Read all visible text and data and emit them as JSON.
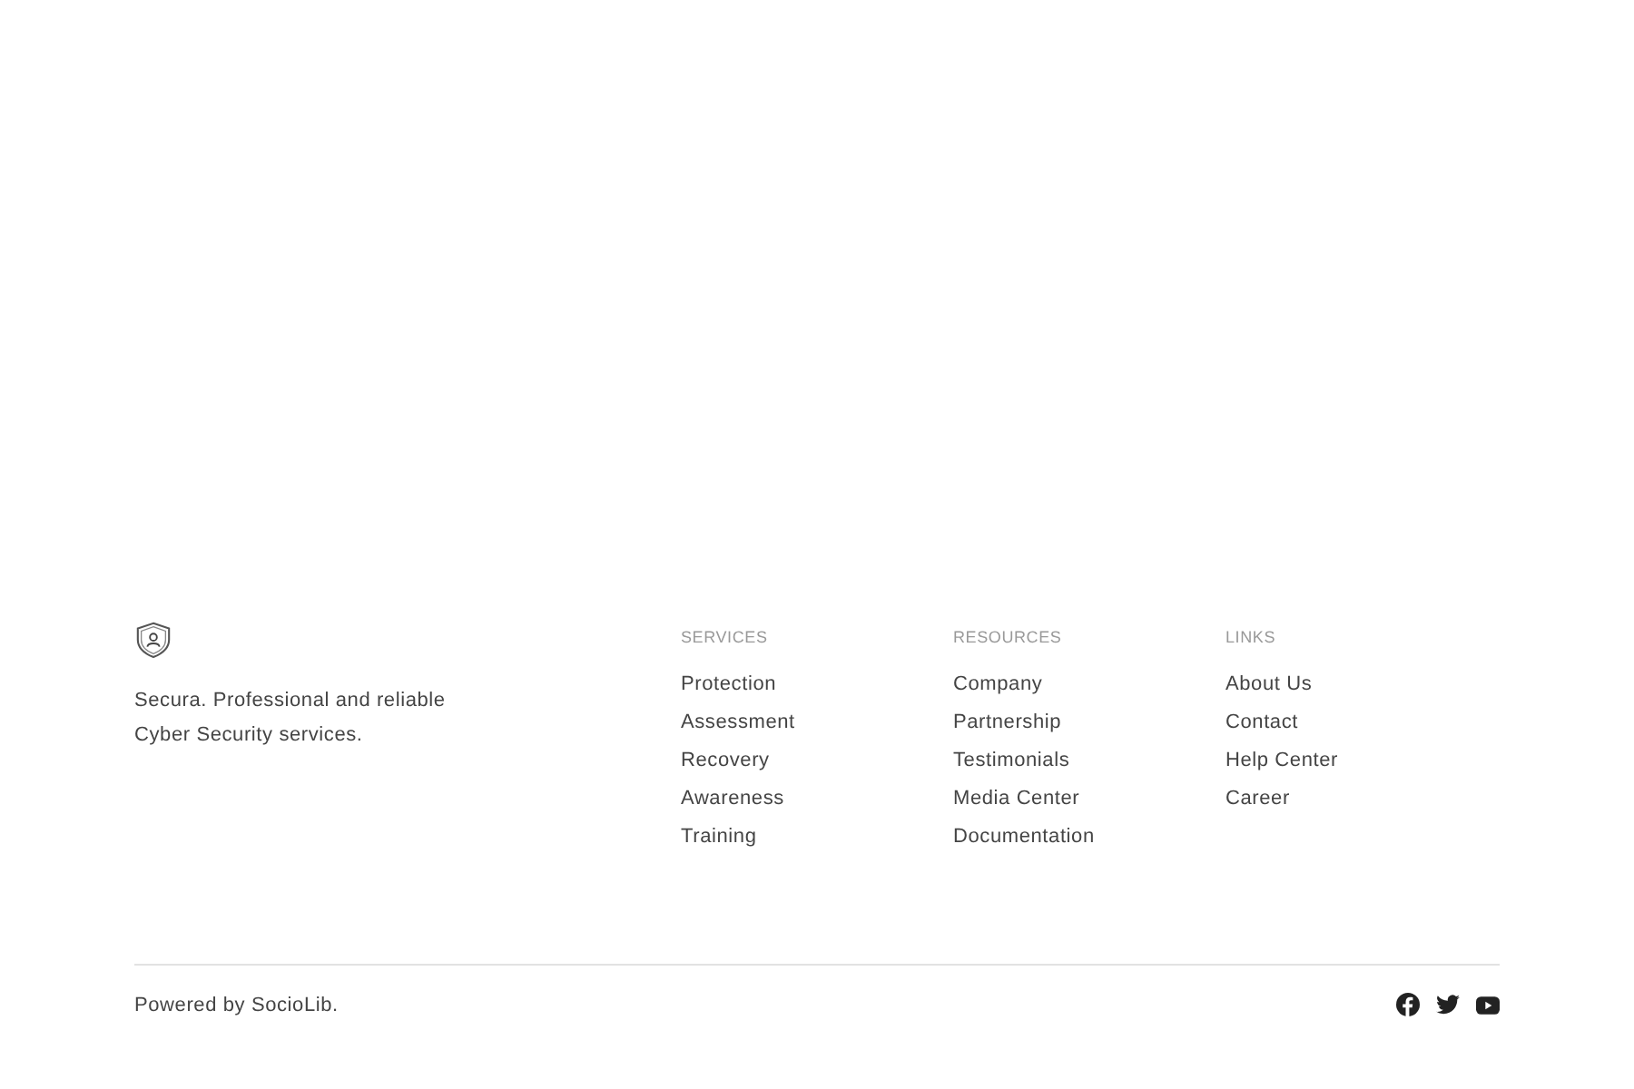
{
  "brand": {
    "description": "Secura. Professional and reliable Cyber Security services."
  },
  "columns": [
    {
      "heading": "SERVICES",
      "links": [
        "Protection",
        "Assessment",
        "Recovery",
        "Awareness",
        "Training"
      ]
    },
    {
      "heading": "RESOURCES",
      "links": [
        "Company",
        "Partnership",
        "Testimonials",
        "Media Center",
        "Documentation"
      ]
    },
    {
      "heading": "LINKS",
      "links": [
        "About Us",
        "Contact",
        "Help Center",
        "Career"
      ]
    }
  ],
  "bottom": {
    "credit": "Powered by SocioLib.",
    "social": [
      {
        "kind": "facebook"
      },
      {
        "kind": "twitter"
      },
      {
        "kind": "youtube"
      }
    ]
  }
}
